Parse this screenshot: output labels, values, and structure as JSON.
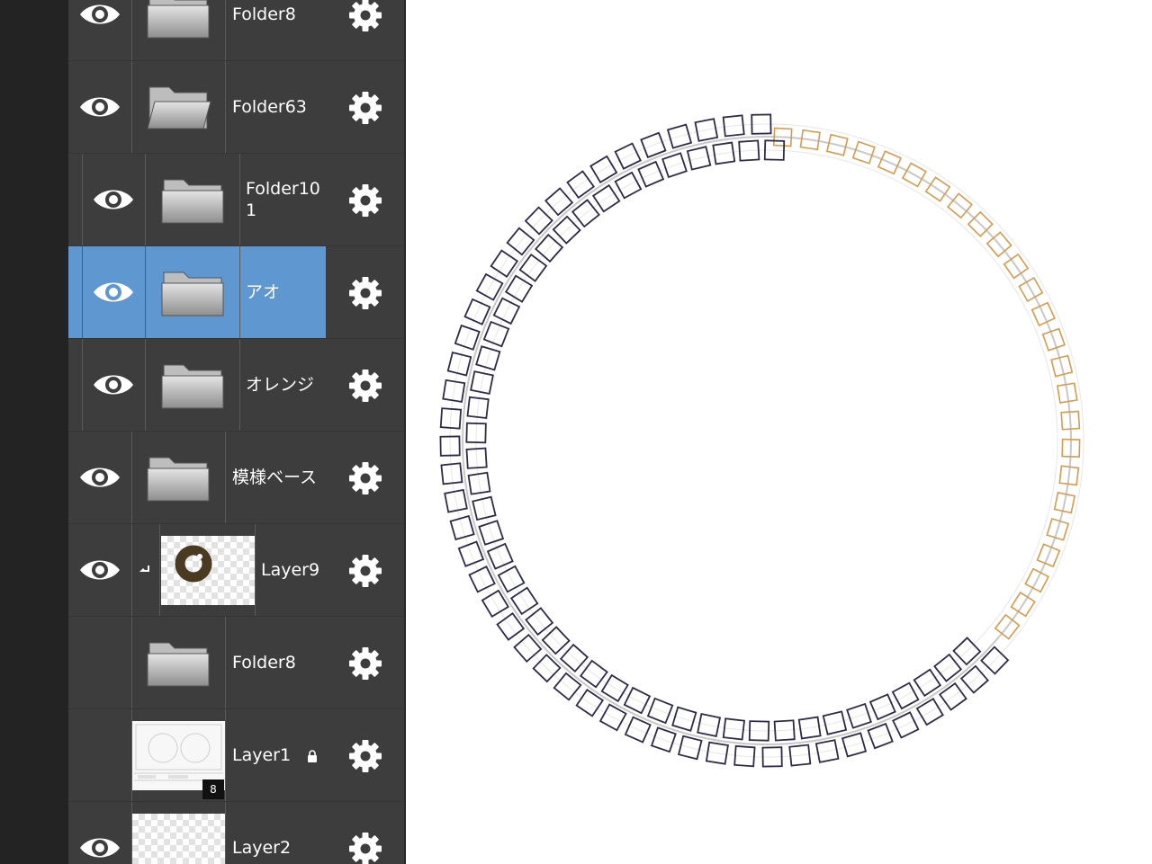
{
  "layers_panel": {
    "rows": [
      {
        "label": "Folder8",
        "type": "folder",
        "visible": true
      },
      {
        "label": "Folder63",
        "type": "folder",
        "visible": true
      },
      {
        "label": "Folder10\n1",
        "type": "folder",
        "visible": true
      },
      {
        "label": "アオ",
        "type": "folder",
        "visible": true,
        "selected": true
      },
      {
        "label": "オレンジ",
        "type": "folder",
        "visible": true
      },
      {
        "label": "模様ベース",
        "type": "folder",
        "visible": true
      },
      {
        "label": "Layer9",
        "type": "layer",
        "visible": true,
        "clipped": true
      },
      {
        "label": "Folder8",
        "type": "folder",
        "visible": false
      },
      {
        "label": "Layer1",
        "type": "layer",
        "visible": false,
        "locked": true,
        "badge": "8"
      },
      {
        "label": "Layer2",
        "type": "layer",
        "visible": true
      }
    ]
  },
  "colors": {
    "panel_bg": "#3d3d3d",
    "selected_bg": "#5f97d0",
    "navy_squares": "#2c2c4a",
    "orange_squares": "#d89a4c",
    "guide_ring": "#c8c8c8"
  },
  "icons": [
    "eye-icon",
    "folder-icon",
    "gear-icon",
    "lock-icon",
    "clip-arrow-icon"
  ]
}
